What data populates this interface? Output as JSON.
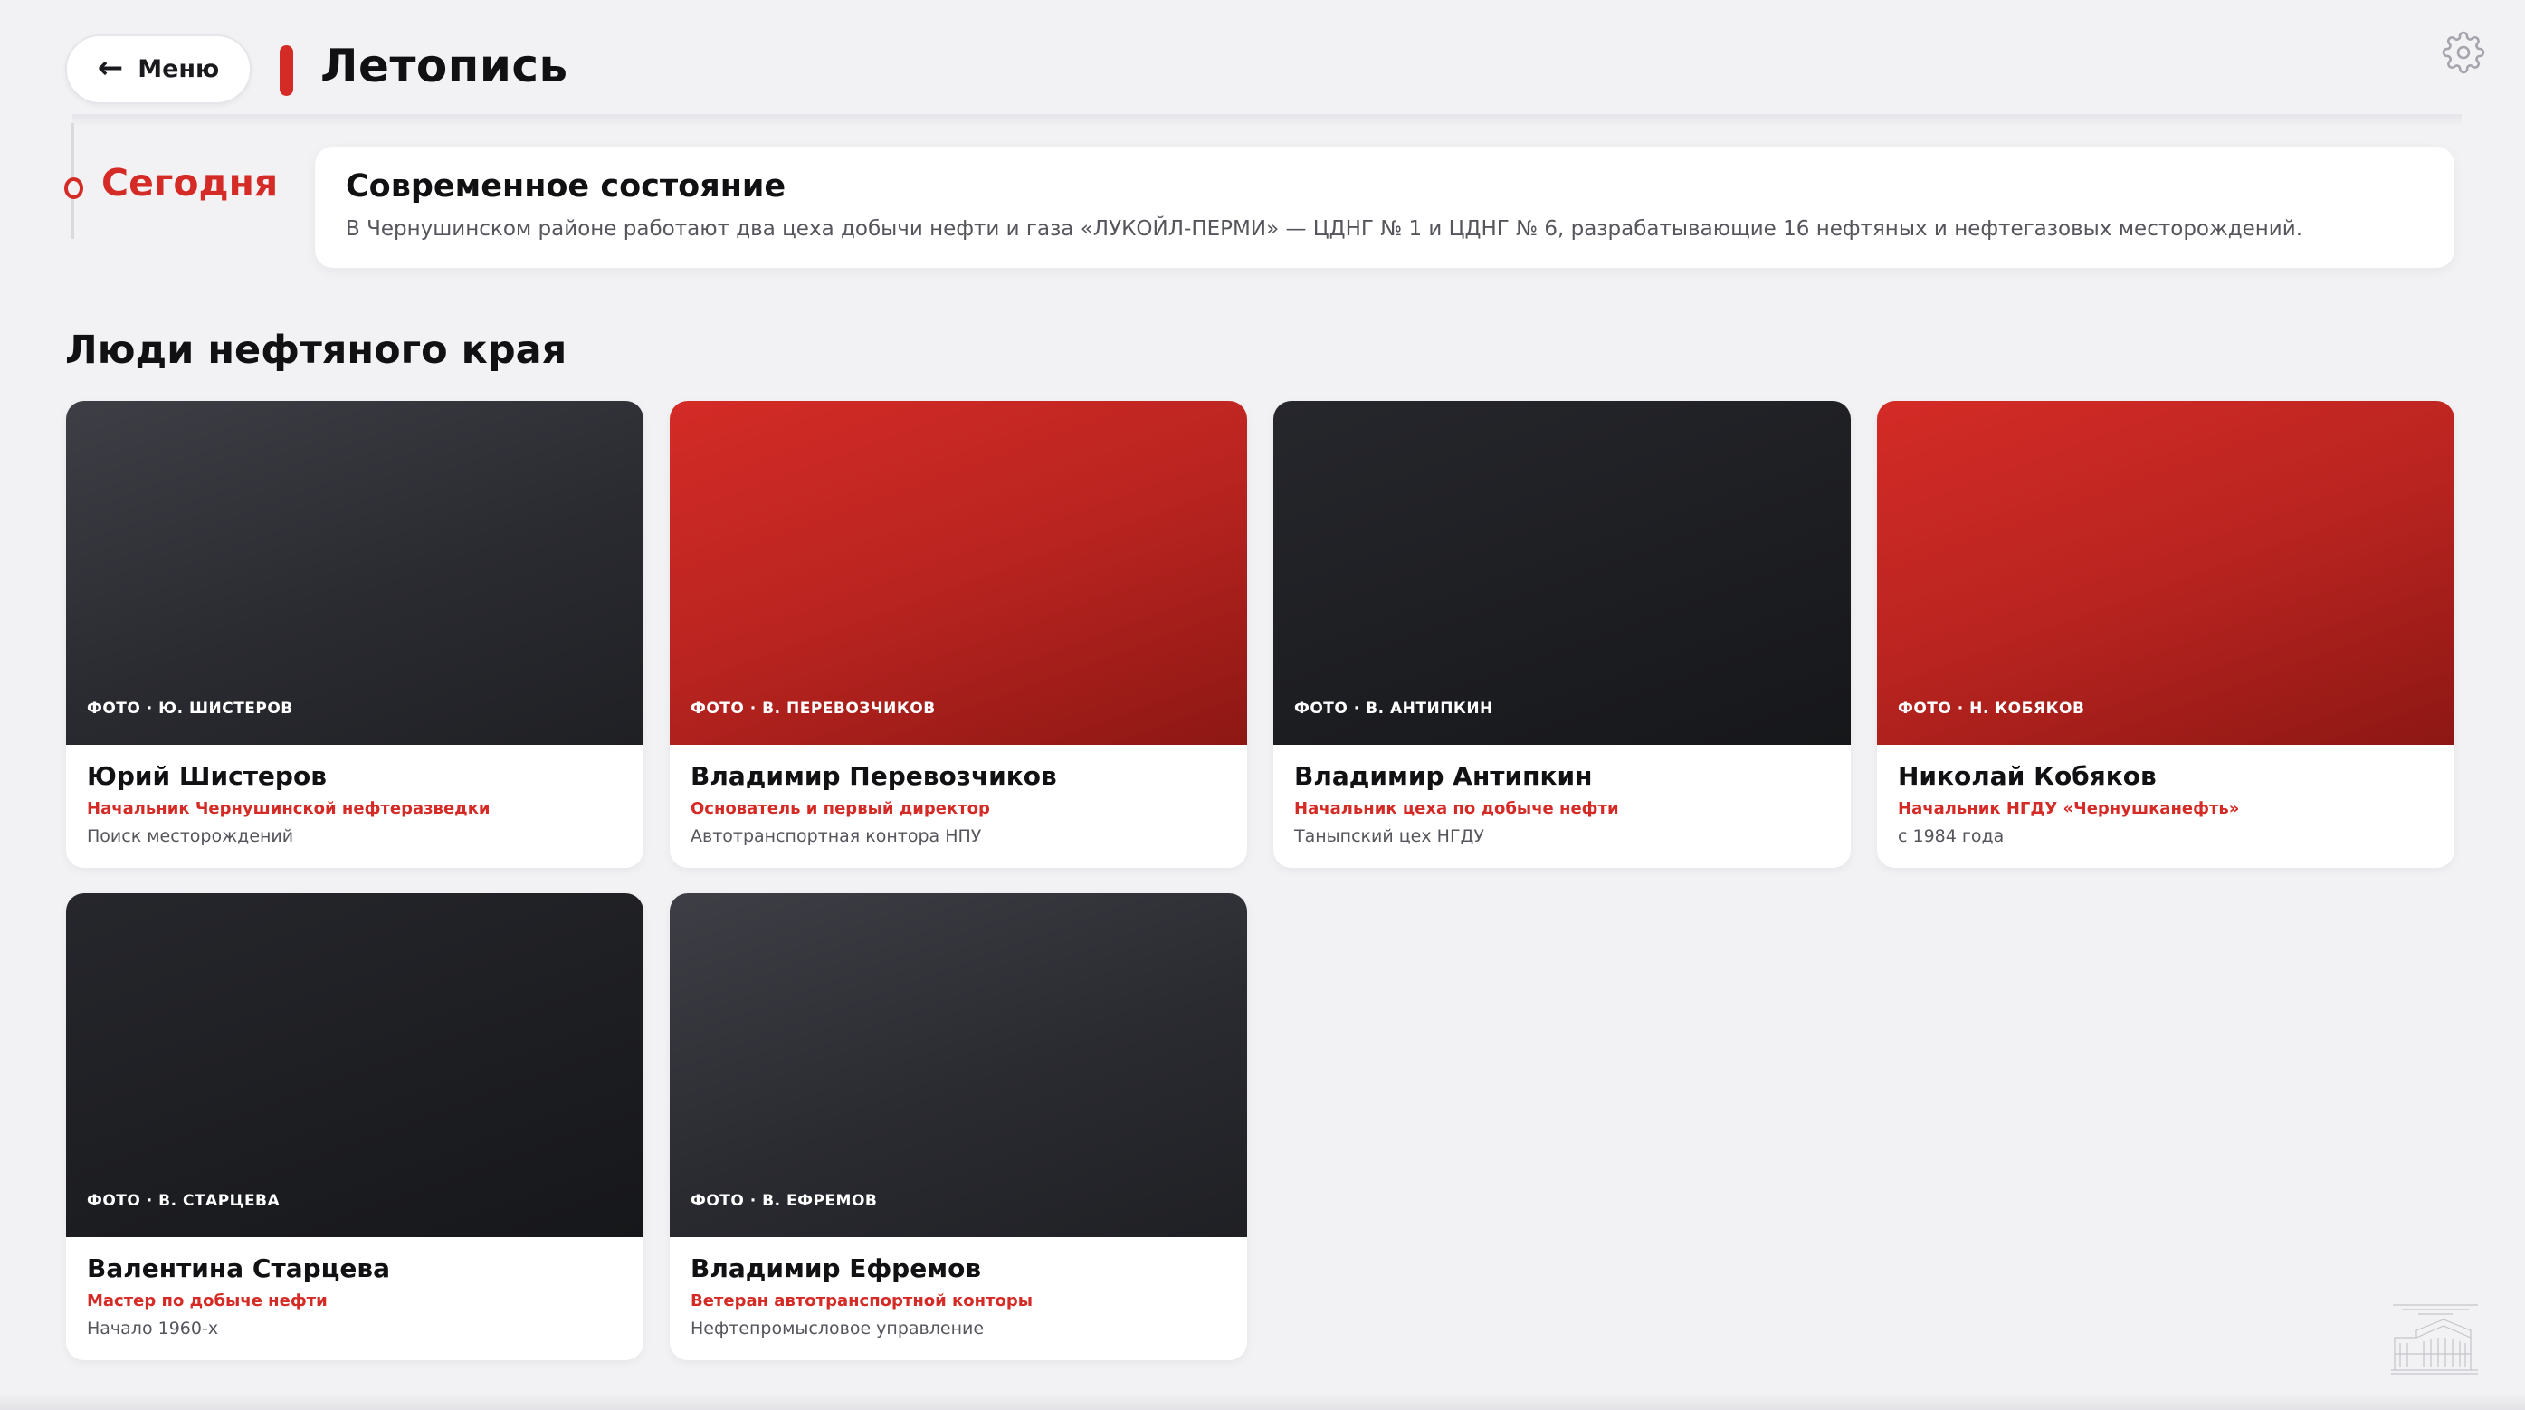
{
  "header": {
    "menu_label": "Меню",
    "title": "Летопись",
    "settings_icon": "gear-icon"
  },
  "timeline": {
    "period_label": "Сегодня",
    "card_title": "Современное состояние",
    "card_text": "В Чернушинском районе работают два цеха добычи нефти и газа «ЛУКОЙЛ-ПЕРМИ» — ЦДНГ № 1 и ЦДНГ № 6, разрабатывающие 16 нефтяных и нефтегазовых месторождений."
  },
  "people": {
    "section_title": "Люди нефтяного края",
    "cards": [
      {
        "credit": "ФОТО · Ю. ШИСТЕРОВ",
        "name": "Юрий Шистеров",
        "role": "Начальник Чернушинской нефтеразведки",
        "note": "Поиск месторождений",
        "tone": "gray"
      },
      {
        "credit": "ФОТО · В. ПЕРЕВОЗЧИКОВ",
        "name": "Владимир Перевозчиков",
        "role": "Основатель и первый директор",
        "note": "Автотранспортная контора НПУ",
        "tone": "red"
      },
      {
        "credit": "ФОТО · В. АНТИПКИН",
        "name": "Владимир Антипкин",
        "role": "Начальник цеха по добыче нефти",
        "note": "Таныпский цех НГДУ",
        "tone": "dark"
      },
      {
        "credit": "ФОТО · Н. КОБЯКОВ",
        "name": "Николай Кобяков",
        "role": "Начальник НГДУ «Чернушканефть»",
        "note": "с 1984 года",
        "tone": "red"
      },
      {
        "credit": "ФОТО · В. СТАРЦЕВА",
        "name": "Валентина Старцева",
        "role": "Мастер по добыче нефти",
        "note": "Начало 1960-х",
        "tone": "dark"
      },
      {
        "credit": "ФОТО · В. ЕФРЕМОВ",
        "name": "Владимир Ефремов",
        "role": "Ветеран автотранспортной конторы",
        "note": "Нефтепромысловое управление",
        "tone": "gray"
      }
    ]
  },
  "colors": {
    "accent": "#d52b26",
    "background": "#f2f2f4",
    "card": "#ffffff"
  }
}
